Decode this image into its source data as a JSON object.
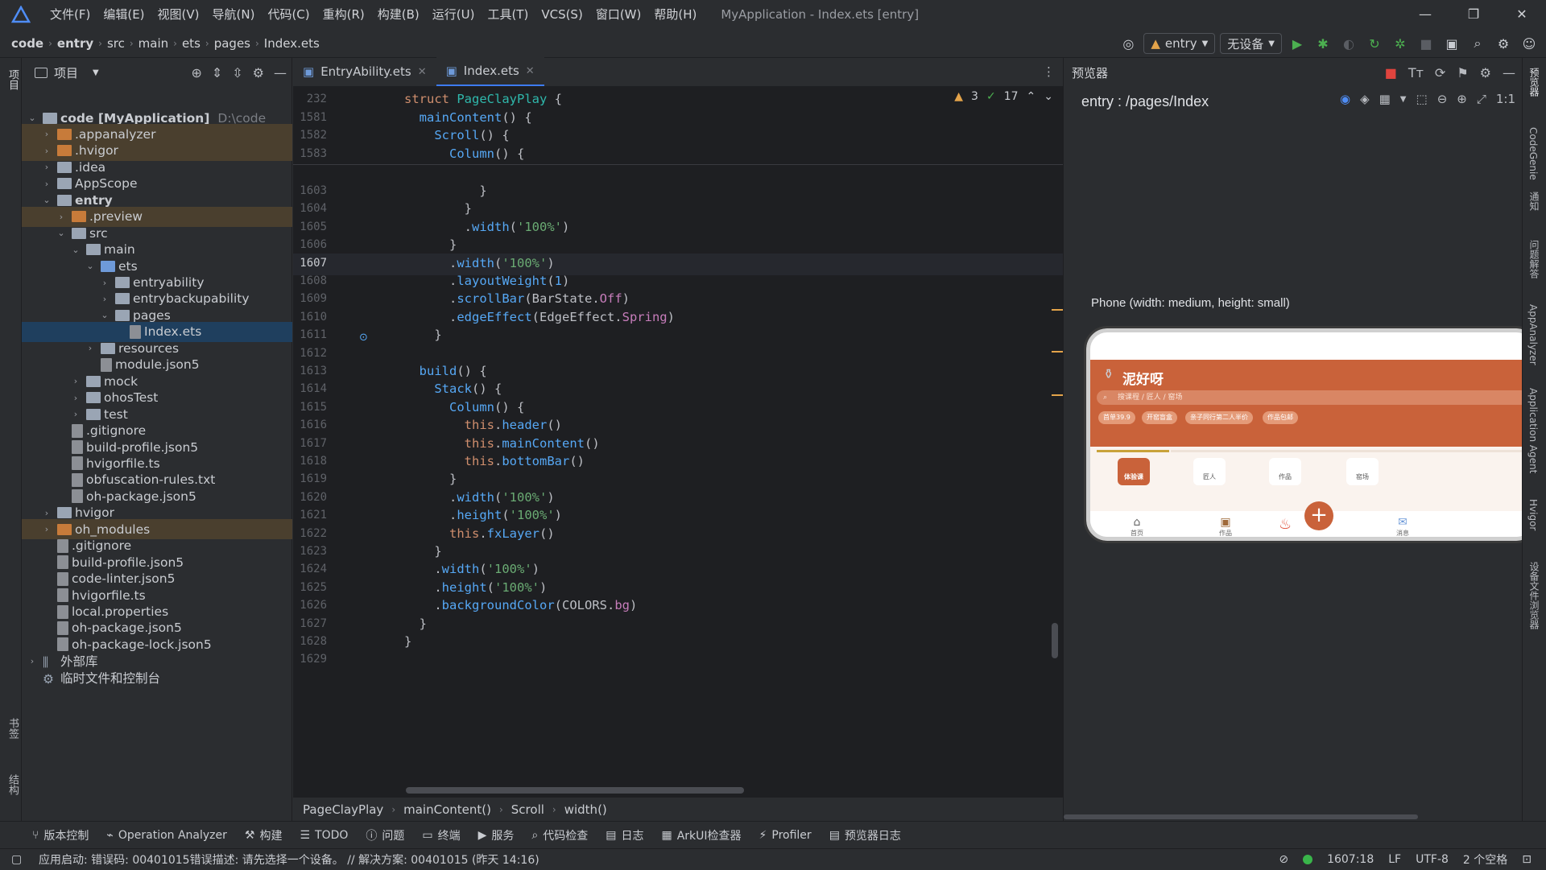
{
  "window": {
    "title": "MyApplication - Index.ets [entry]",
    "menu": [
      "文件(F)",
      "编辑(E)",
      "视图(V)",
      "导航(N)",
      "代码(C)",
      "重构(R)",
      "构建(B)",
      "运行(U)",
      "工具(T)",
      "VCS(S)",
      "窗口(W)",
      "帮助(H)"
    ],
    "controls": [
      "—",
      "❐",
      "✕"
    ]
  },
  "navbar": {
    "crumbs": [
      "code",
      "entry",
      "src",
      "main",
      "ets",
      "pages",
      "Index.ets"
    ],
    "module_combo": "entry",
    "device_combo": "无设备"
  },
  "project": {
    "title": "项目",
    "tree": [
      {
        "label": "code [MyApplication]",
        "extra": "D:\\code",
        "depth": 0,
        "open": true,
        "icon": "folder",
        "bold": true
      },
      {
        "label": ".appanalyzer",
        "depth": 1,
        "open": false,
        "icon": "folder-orange",
        "hl": true
      },
      {
        "label": ".hvigor",
        "depth": 1,
        "open": false,
        "icon": "folder-orange",
        "hl": true
      },
      {
        "label": ".idea",
        "depth": 1,
        "open": false,
        "icon": "folder"
      },
      {
        "label": "AppScope",
        "depth": 1,
        "open": false,
        "icon": "folder"
      },
      {
        "label": "entry",
        "depth": 1,
        "open": true,
        "icon": "folder-module",
        "bold": true
      },
      {
        "label": ".preview",
        "depth": 2,
        "open": false,
        "icon": "folder-orange",
        "hl": true
      },
      {
        "label": "src",
        "depth": 2,
        "open": true,
        "icon": "folder"
      },
      {
        "label": "main",
        "depth": 3,
        "open": true,
        "icon": "folder"
      },
      {
        "label": "ets",
        "depth": 4,
        "open": true,
        "icon": "folder-blue"
      },
      {
        "label": "entryability",
        "depth": 5,
        "open": false,
        "icon": "folder"
      },
      {
        "label": "entrybackupability",
        "depth": 5,
        "open": false,
        "icon": "folder"
      },
      {
        "label": "pages",
        "depth": 5,
        "open": true,
        "icon": "folder"
      },
      {
        "label": "Index.ets",
        "depth": 6,
        "icon": "file",
        "sel": true
      },
      {
        "label": "resources",
        "depth": 4,
        "open": false,
        "icon": "folder"
      },
      {
        "label": "module.json5",
        "depth": 4,
        "icon": "file"
      },
      {
        "label": "mock",
        "depth": 3,
        "open": false,
        "icon": "folder"
      },
      {
        "label": "ohosTest",
        "depth": 3,
        "open": false,
        "icon": "folder"
      },
      {
        "label": "test",
        "depth": 3,
        "open": false,
        "icon": "folder"
      },
      {
        "label": ".gitignore",
        "depth": 2,
        "icon": "file"
      },
      {
        "label": "build-profile.json5",
        "depth": 2,
        "icon": "file"
      },
      {
        "label": "hvigorfile.ts",
        "depth": 2,
        "icon": "file"
      },
      {
        "label": "obfuscation-rules.txt",
        "depth": 2,
        "icon": "file"
      },
      {
        "label": "oh-package.json5",
        "depth": 2,
        "icon": "file"
      },
      {
        "label": "hvigor",
        "depth": 1,
        "open": false,
        "icon": "folder"
      },
      {
        "label": "oh_modules",
        "depth": 1,
        "open": false,
        "icon": "folder-orange",
        "hl": true
      },
      {
        "label": ".gitignore",
        "depth": 1,
        "icon": "file"
      },
      {
        "label": "build-profile.json5",
        "depth": 1,
        "icon": "file"
      },
      {
        "label": "code-linter.json5",
        "depth": 1,
        "icon": "file"
      },
      {
        "label": "hvigorfile.ts",
        "depth": 1,
        "icon": "file"
      },
      {
        "label": "local.properties",
        "depth": 1,
        "icon": "file"
      },
      {
        "label": "oh-package.json5",
        "depth": 1,
        "icon": "file"
      },
      {
        "label": "oh-package-lock.json5",
        "depth": 1,
        "icon": "file"
      },
      {
        "label": "外部库",
        "depth": 0,
        "open": false,
        "icon": "lib"
      },
      {
        "label": "临时文件和控制台",
        "depth": 0,
        "icon": "scratch"
      }
    ]
  },
  "tabs": [
    {
      "label": "EntryAbility.ets",
      "active": false
    },
    {
      "label": "Index.ets",
      "active": true
    }
  ],
  "inspections": {
    "warnings": "3",
    "ok": "17"
  },
  "code": [
    {
      "n": "232",
      "html": "<span class='kw'>struct</span> <span class='cls'>PageClayPlay</span> {"
    },
    {
      "n": "1581",
      "html": "  <span class='fn'>mainContent</span>() {"
    },
    {
      "n": "1582",
      "html": "    <span class='fn'>Scroll</span>() {"
    },
    {
      "n": "1583",
      "html": "      <span class='fn'>Column</span>() {"
    },
    {
      "n": "1603",
      "html": "          }"
    },
    {
      "n": "1604",
      "html": "        }"
    },
    {
      "n": "1605",
      "html": "        .<span class='fn'>width</span>(<span class='str'>'100%'</span>)"
    },
    {
      "n": "1606",
      "html": "      }"
    },
    {
      "n": "1607",
      "html": "      .<span class='fn'>width</span>(<span class='str'>'100%'</span>)",
      "cur": true
    },
    {
      "n": "1608",
      "html": "      .<span class='fn'>layoutWeight</span>(<span class='fn'>1</span>)"
    },
    {
      "n": "1609",
      "html": "      .<span class='fn'>scrollBar</span>(BarState.<span class='pur'>Off</span>)"
    },
    {
      "n": "1610",
      "html": "      .<span class='fn'>edgeEffect</span>(EdgeEffect.<span class='pur'>Spring</span>)"
    },
    {
      "n": "1611",
      "html": "    }"
    },
    {
      "n": "1612",
      "html": ""
    },
    {
      "n": "1613",
      "html": "  <span class='fn'>build</span>() {"
    },
    {
      "n": "1614",
      "html": "    <span class='fn'>Stack</span>() {"
    },
    {
      "n": "1615",
      "html": "      <span class='fn'>Column</span>() {"
    },
    {
      "n": "1616",
      "html": "        <span class='kw'>this</span>.<span class='fn'>header</span>()"
    },
    {
      "n": "1617",
      "html": "        <span class='kw'>this</span>.<span class='fn'>mainContent</span>()"
    },
    {
      "n": "1618",
      "html": "        <span class='kw'>this</span>.<span class='fn'>bottomBar</span>()"
    },
    {
      "n": "1619",
      "html": "      }"
    },
    {
      "n": "1620",
      "html": "      .<span class='fn'>width</span>(<span class='str'>'100%'</span>)"
    },
    {
      "n": "1621",
      "html": "      .<span class='fn'>height</span>(<span class='str'>'100%'</span>)"
    },
    {
      "n": "1622",
      "html": "      <span class='kw'>this</span>.<span class='fn'>fxLayer</span>()"
    },
    {
      "n": "1623",
      "html": "    }"
    },
    {
      "n": "1624",
      "html": "    .<span class='fn'>width</span>(<span class='str'>'100%'</span>)"
    },
    {
      "n": "1625",
      "html": "    .<span class='fn'>height</span>(<span class='str'>'100%'</span>)"
    },
    {
      "n": "1626",
      "html": "    .<span class='fn'>backgroundColor</span>(COLORS.<span class='pur'>bg</span>)"
    },
    {
      "n": "1627",
      "html": "  }"
    },
    {
      "n": "1628",
      "html": "}"
    },
    {
      "n": "1629",
      "html": ""
    }
  ],
  "editor_crumbs": [
    "PageClayPlay",
    "mainContent()",
    "Scroll",
    "width()"
  ],
  "previewer": {
    "title": "预览器",
    "path": "entry : /pages/Index",
    "device_label": "Phone (width: medium, height: small)",
    "app": {
      "title": "泥好呀",
      "search_placeholder": "搜课程 / 匠人 / 窑场",
      "chips": [
        "首单39.9",
        "开窑盲盒",
        "亲子同行第二人半价",
        "作品包邮"
      ],
      "categories": [
        "体验课",
        "匠人",
        "作品",
        "窑场"
      ],
      "bottom_tabs": [
        "首页",
        "作品",
        "消息"
      ]
    }
  },
  "right_strip": [
    "预览器",
    "CodeGenie",
    "通知",
    "问题解答",
    "AppAnalyzer",
    "Application Agent",
    "Hvigor",
    "设备文件浏览器"
  ],
  "left_strip": [
    "项目",
    "书签",
    "结构"
  ],
  "toolbar": [
    "版本控制",
    "Operation Analyzer",
    "构建",
    "TODO",
    "问题",
    "终端",
    "服务",
    "代码检查",
    "日志",
    "ArkUI检查器",
    "Profiler",
    "预览器日志"
  ],
  "status": {
    "message": "应用启动: 错误码: 00401015错误描述: 请先选择一个设备。 // 解决方案: 00401015 (昨天 14:16)",
    "position": "1607:18",
    "line_sep": "LF",
    "encoding": "UTF-8",
    "indent": "2 个空格"
  }
}
